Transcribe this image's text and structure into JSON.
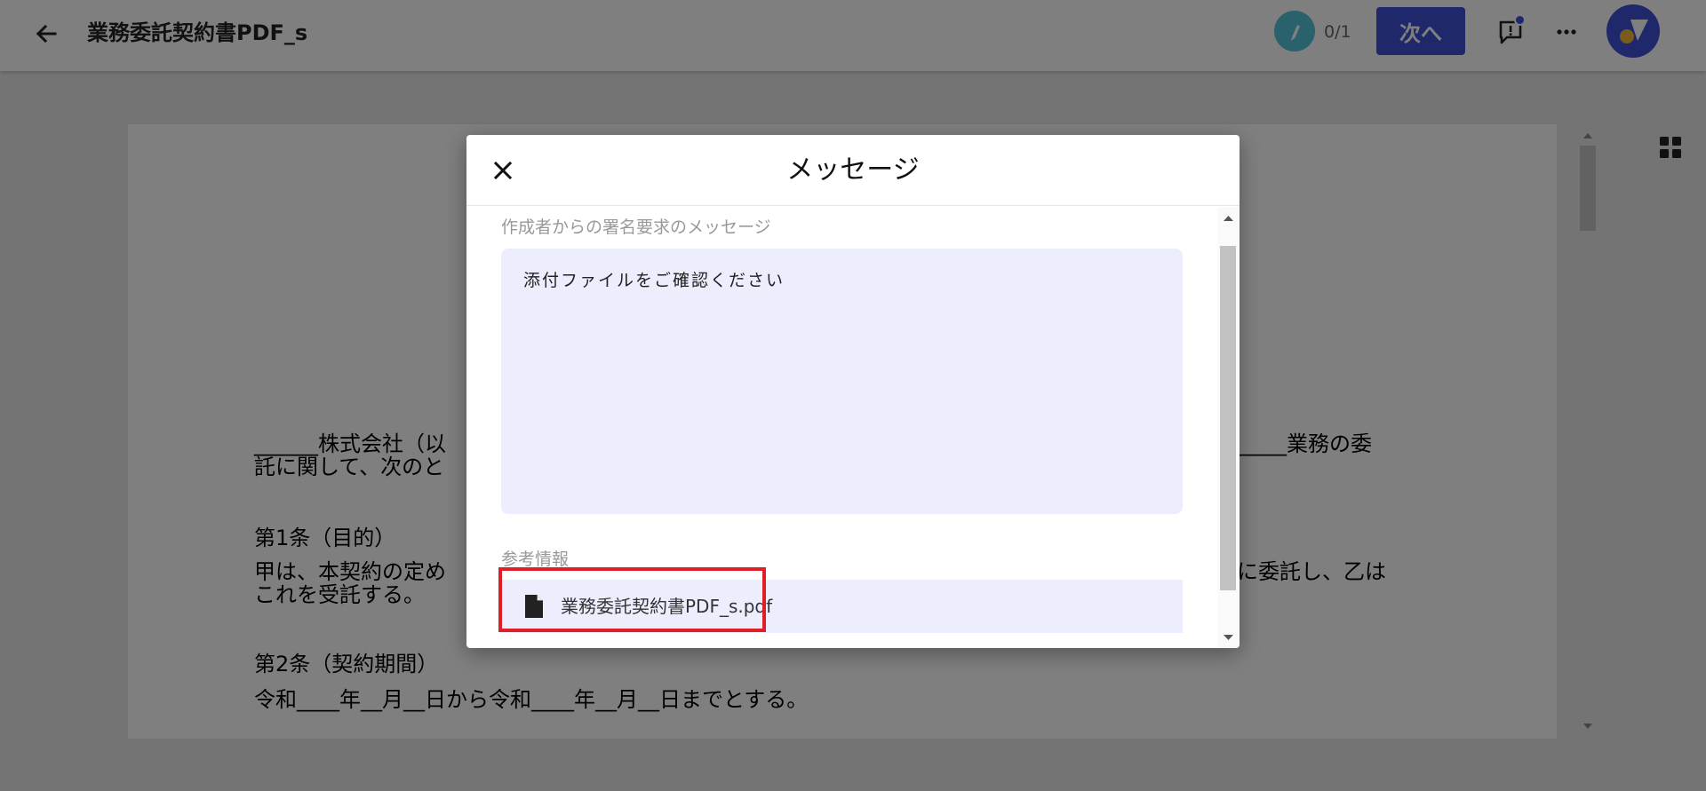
{
  "header": {
    "title": "業務委託契約書PDF_s",
    "progress": "0/1",
    "next_label": "次へ",
    "icons": [
      "arrow-left-icon",
      "pen-icon",
      "comment-alert-icon",
      "more-horizontal-icon",
      "logo-avatar"
    ]
  },
  "document": {
    "lines": [
      "______株式会社（以",
      "託に関して、次のと",
      "第1条（目的）",
      "甲は、本契約の定め",
      "これを受託する。",
      "第2条（契約期間）",
      "令和____年__月__日から令和____年__月__日までとする。"
    ],
    "right_fragments": [
      "______業務の委",
      "に委託し、乙は"
    ]
  },
  "modal": {
    "title": "メッセージ",
    "message_section_label": "作成者からの署名要求のメッセージ",
    "message_text": "添付ファイルをご確認ください",
    "reference_section_label": "参考情報",
    "attachment_name": "業務委託契約書PDF_s.pdf"
  },
  "colors": {
    "accent": "#3f51d4",
    "message_bg": "#eceefd",
    "highlight": "#e01e27",
    "pen_badge": "#52c2d8",
    "logo_yellow": "#f2b73b"
  }
}
